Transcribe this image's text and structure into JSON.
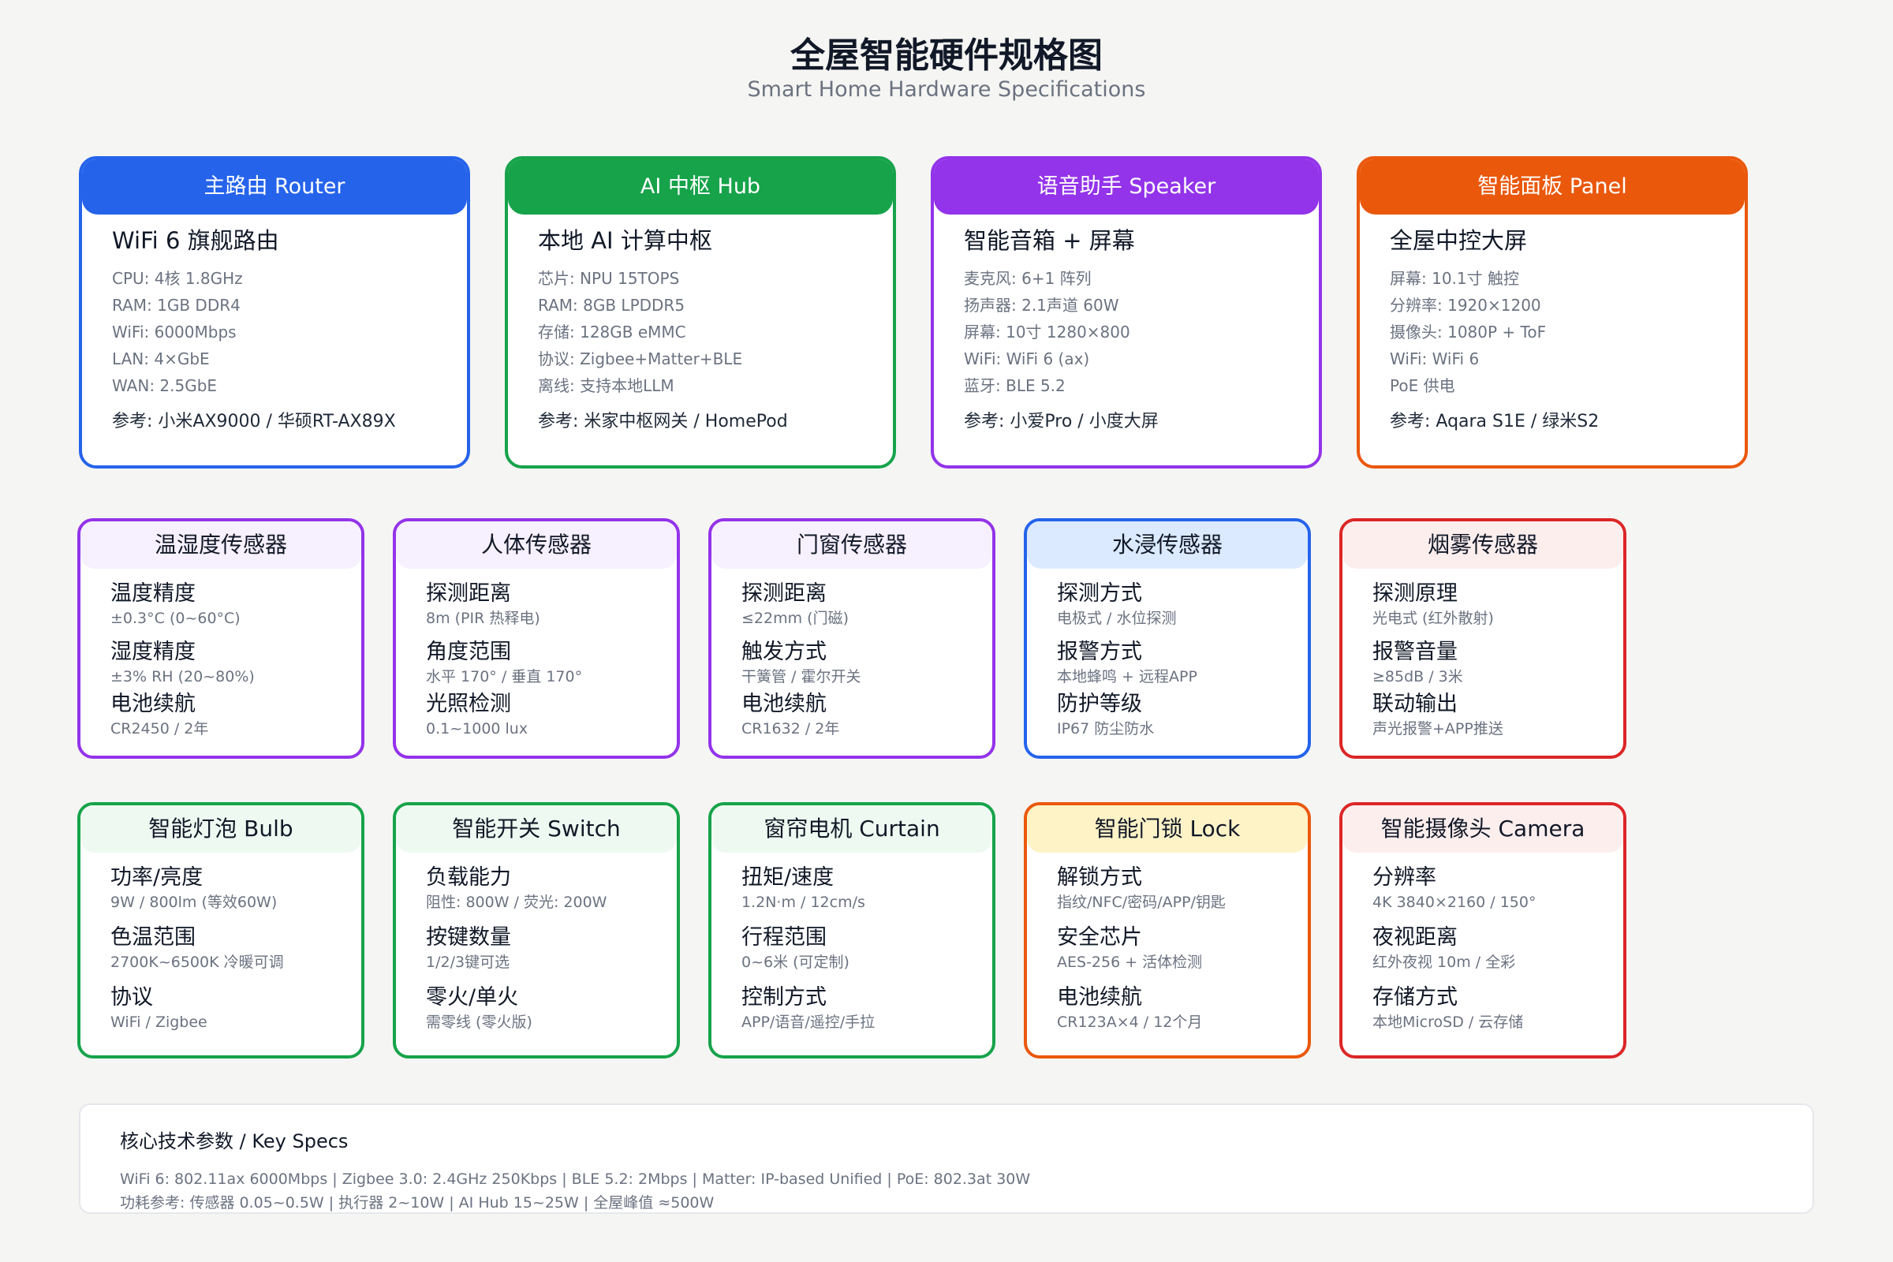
{
  "page": {
    "title": "全屋智能硬件规格图",
    "subtitle": "Smart Home Hardware Specifications"
  },
  "colors": {
    "router": "#2563eb",
    "hub": "#16a34a",
    "speaker": "#9333ea",
    "panel": "#ea580c",
    "purple_border": "#9333ea",
    "purple_head": "#f7f0fe",
    "blue_border": "#2563eb",
    "blue_head": "#dbeafe",
    "red_border": "#dc2626",
    "red_head": "#fdeeee",
    "green_border": "#16a34a",
    "green_head": "#eefaf1",
    "orange_border": "#ea580c",
    "yellow_head": "#fef3c7"
  },
  "hardware": [
    {
      "header": "主路由 Router",
      "product": "WiFi 6 旗舰路由",
      "specs": [
        "CPU: 4核 1.8GHz",
        "RAM: 1GB DDR4",
        "WiFi: 6000Mbps",
        "LAN: 4×GbE",
        "WAN: 2.5GbE"
      ],
      "reference": "参考: 小米AX9000 / 华硕RT-AX89X"
    },
    {
      "header": "AI 中枢 Hub",
      "product": "本地 AI 计算中枢",
      "specs": [
        "芯片: NPU 15TOPS",
        "RAM: 8GB LPDDR5",
        "存储: 128GB eMMC",
        "协议: Zigbee+Matter+BLE",
        "离线: 支持本地LLM"
      ],
      "reference": "参考: 米家中枢网关 / HomePod"
    },
    {
      "header": "语音助手 Speaker",
      "product": "智能音箱 + 屏幕",
      "specs": [
        "麦克风: 6+1 阵列",
        "扬声器: 2.1声道 60W",
        "屏幕: 10寸 1280×800",
        "WiFi: WiFi 6 (ax)",
        "蓝牙: BLE 5.2"
      ],
      "reference": "参考: 小爱Pro / 小度大屏"
    },
    {
      "header": "智能面板 Panel",
      "product": "全屋中控大屏",
      "specs": [
        "屏幕: 10.1寸 触控",
        "分辨率: 1920×1200",
        "摄像头: 1080P + ToF",
        "WiFi: WiFi 6",
        "PoE 供电"
      ],
      "reference": "参考: Aqara S1E / 绿米S2"
    }
  ],
  "sensors": [
    {
      "header": "温湿度传感器",
      "features": [
        {
          "label": "温度精度",
          "value": "±0.3°C (0~60°C)"
        },
        {
          "label": "湿度精度",
          "value": "±3% RH (20~80%)"
        },
        {
          "label": "电池续航",
          "value": "CR2450 / 2年"
        }
      ]
    },
    {
      "header": "人体传感器",
      "features": [
        {
          "label": "探测距离",
          "value": "8m (PIR 热释电)"
        },
        {
          "label": "角度范围",
          "value": "水平 170° / 垂直 170°"
        },
        {
          "label": "光照检测",
          "value": "0.1~1000 lux"
        }
      ]
    },
    {
      "header": "门窗传感器",
      "features": [
        {
          "label": "探测距离",
          "value": "≤22mm (门磁)"
        },
        {
          "label": "触发方式",
          "value": "干簧管 / 霍尔开关"
        },
        {
          "label": "电池续航",
          "value": "CR1632 / 2年"
        }
      ]
    },
    {
      "header": "水浸传感器",
      "features": [
        {
          "label": "探测方式",
          "value": "电极式 / 水位探测"
        },
        {
          "label": "报警方式",
          "value": "本地蜂鸣 + 远程APP"
        },
        {
          "label": "防护等级",
          "value": "IP67 防尘防水"
        }
      ]
    },
    {
      "header": "烟雾传感器",
      "features": [
        {
          "label": "探测原理",
          "value": "光电式 (红外散射)"
        },
        {
          "label": "报警音量",
          "value": "≥85dB / 3米"
        },
        {
          "label": "联动输出",
          "value": "声光报警+APP推送"
        }
      ]
    }
  ],
  "devices": [
    {
      "header": "智能灯泡 Bulb",
      "features": [
        {
          "label": "功率/亮度",
          "value": "9W / 800lm (等效60W)"
        },
        {
          "label": "色温范围",
          "value": "2700K~6500K 冷暖可调"
        },
        {
          "label": "协议",
          "value": "WiFi / Zigbee"
        }
      ]
    },
    {
      "header": "智能开关 Switch",
      "features": [
        {
          "label": "负载能力",
          "value": "阻性: 800W / 荧光: 200W"
        },
        {
          "label": "按键数量",
          "value": "1/2/3键可选"
        },
        {
          "label": "零火/单火",
          "value": "需零线 (零火版)"
        }
      ]
    },
    {
      "header": "窗帘电机 Curtain",
      "features": [
        {
          "label": "扭矩/速度",
          "value": "1.2N·m / 12cm/s"
        },
        {
          "label": "行程范围",
          "value": "0~6米 (可定制)"
        },
        {
          "label": "控制方式",
          "value": "APP/语音/遥控/手拉"
        }
      ]
    },
    {
      "header": "智能门锁 Lock",
      "features": [
        {
          "label": "解锁方式",
          "value": "指纹/NFC/密码/APP/钥匙"
        },
        {
          "label": "安全芯片",
          "value": "AES-256 + 活体检测"
        },
        {
          "label": "电池续航",
          "value": "CR123A×4 / 12个月"
        }
      ]
    },
    {
      "header": "智能摄像头 Camera",
      "features": [
        {
          "label": "分辨率",
          "value": "4K 3840×2160 / 150°"
        },
        {
          "label": "夜视距离",
          "value": "红外夜视 10m / 全彩"
        },
        {
          "label": "存储方式",
          "value": "本地MicroSD / 云存储"
        }
      ]
    }
  ],
  "key_specs": {
    "title": "核心技术参数 / Key Specs",
    "line1": "WiFi 6: 802.11ax 6000Mbps | Zigbee 3.0: 2.4GHz 250Kbps | BLE 5.2: 2Mbps | Matter: IP-based Unified | PoE: 802.3at 30W",
    "line2": "功耗参考: 传感器 0.05~0.5W | 执行器 2~10W | AI Hub 15~25W | 全屋峰值 ≈500W"
  }
}
